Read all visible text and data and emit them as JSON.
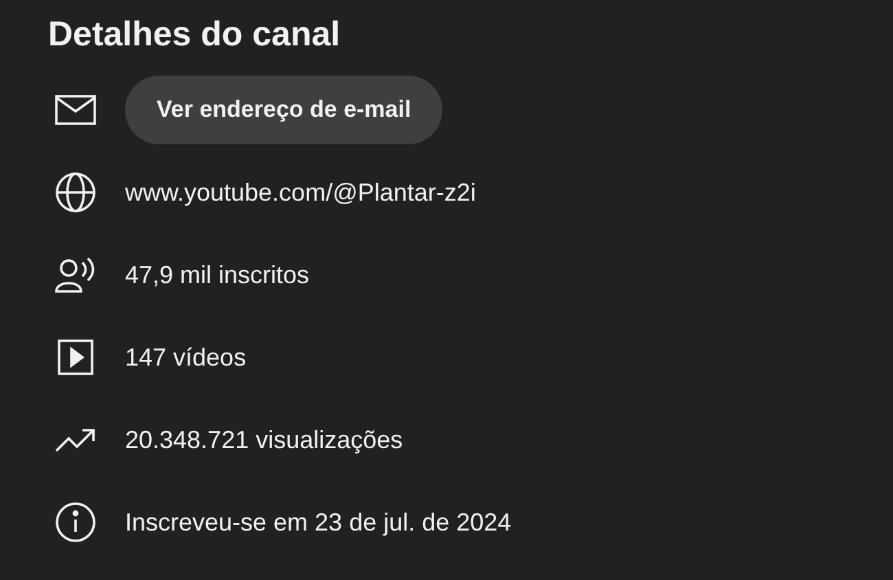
{
  "title": "Detalhes do canal",
  "rows": [
    {
      "kind": "email",
      "button": "Ver endereço de e-mail"
    },
    {
      "kind": "link",
      "text": "www.youtube.com/@Plantar-z2i"
    },
    {
      "kind": "subscribers",
      "text": "47,9 mil inscritos"
    },
    {
      "kind": "videos",
      "text": "147 vídeos"
    },
    {
      "kind": "views",
      "text": "20.348.721 visualizações"
    },
    {
      "kind": "joined",
      "text": "Inscreveu-se em 23 de jul. de 2024"
    }
  ]
}
